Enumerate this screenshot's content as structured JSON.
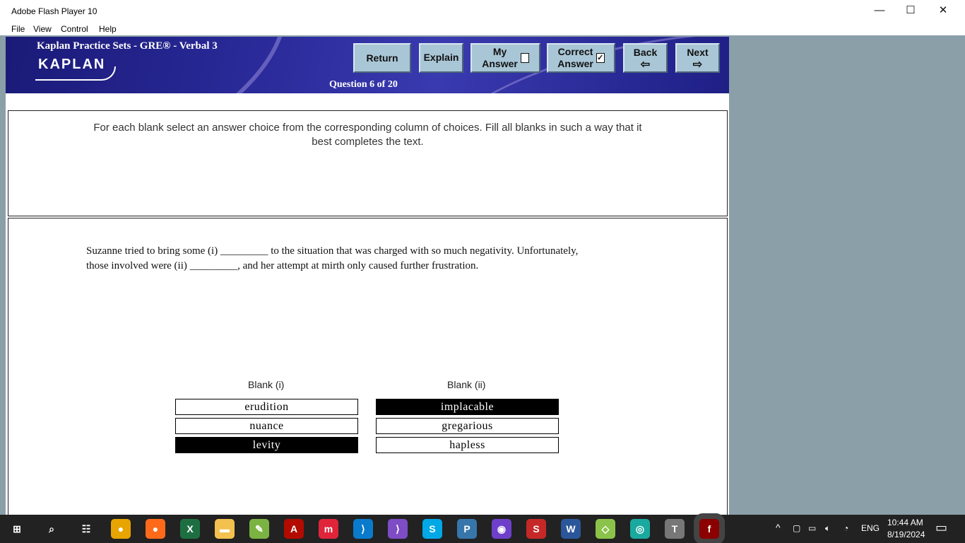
{
  "window": {
    "title": "Adobe Flash Player 10",
    "minimize": "—",
    "maximize": "☐",
    "close": "✕"
  },
  "menu": [
    "File",
    "View",
    "Control",
    "Help"
  ],
  "banner": {
    "title": "Kaplan Practice Sets - GRE® - Verbal 3",
    "logo": "KAPLAN",
    "question": "Question 6 of 20"
  },
  "buttons": {
    "return": "Return",
    "explain": "Explain",
    "my_answer_1": "My",
    "my_answer_2": "Answer",
    "correct_1": "Correct",
    "correct_2": "Answer",
    "correct_check": "✓",
    "back": "Back",
    "next": "Next"
  },
  "instructions": "For each blank select an answer choice from the corresponding column of choices. Fill all blanks in such a way that it best completes the text.",
  "question_text_1": "Suzanne tried to bring some (i) _________ to the situation that was charged with so much negativity. Unfortunately,",
  "question_text_2": "those involved were (ii) _________, and her attempt at mirth only caused further frustration.",
  "blank1": {
    "header": "Blank (i)",
    "choices": [
      "erudition",
      "nuance",
      "levity"
    ],
    "selected": "levity"
  },
  "blank2": {
    "header": "Blank (ii)",
    "choices": [
      "implacable",
      "gregarious",
      "hapless"
    ],
    "selected": "implacable"
  },
  "taskbar": {
    "time": "10:44 AM",
    "date": "8/19/2024",
    "lang": "ENG",
    "apps": [
      "windows-start",
      "search",
      "task-view",
      "chrome",
      "firefox",
      "excel",
      "file-explorer",
      "notepad-plus",
      "acrobat",
      "mendeley",
      "vscode",
      "visual-studio",
      "skype",
      "python",
      "github-desktop",
      "scite",
      "word",
      "app",
      "app2",
      "texmaker",
      "flash-player"
    ]
  },
  "colors": {
    "banner": "#1f1f86",
    "button": "#a9c6d6",
    "selected": "#000000",
    "stage_bg": "#8b9fa9"
  }
}
